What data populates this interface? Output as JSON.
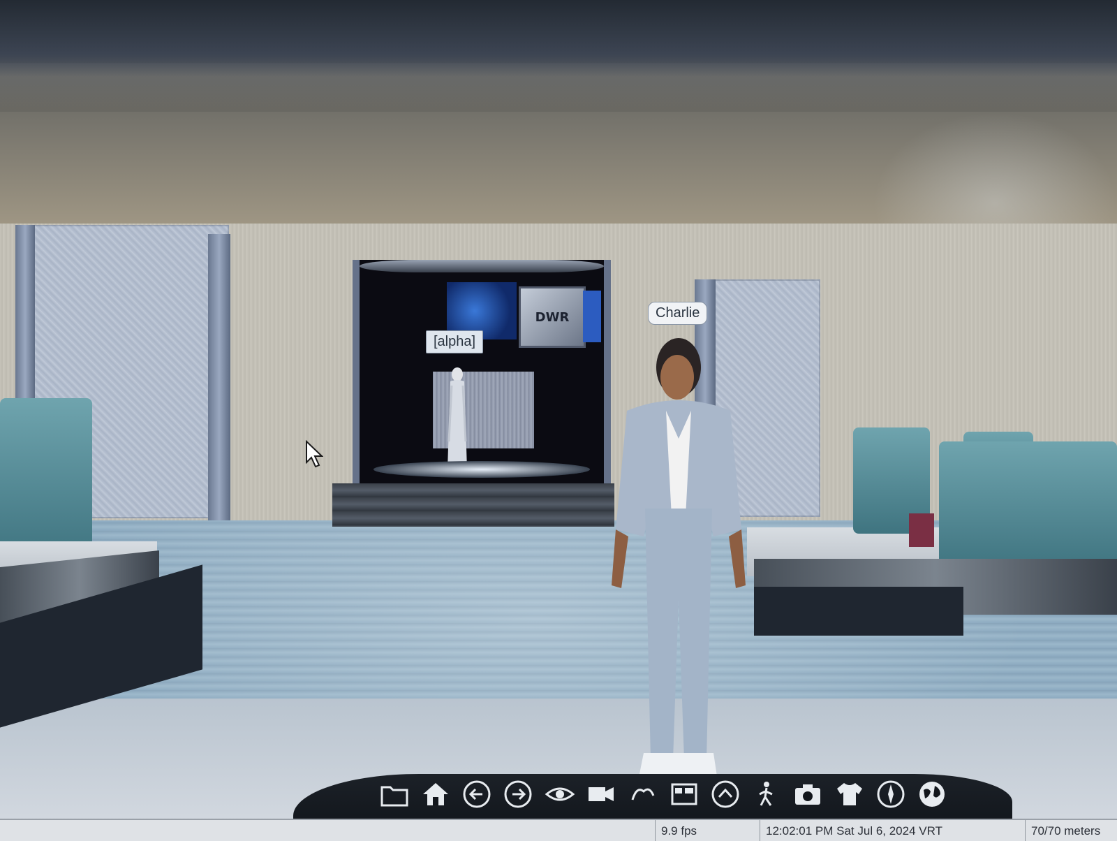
{
  "world": {
    "nametags": {
      "charlie": "Charlie",
      "alpha": "[alpha]"
    },
    "stage_logo": "DWR"
  },
  "toolbar": {
    "items": [
      {
        "name": "folder-icon",
        "icon": "folder"
      },
      {
        "name": "home-icon",
        "icon": "home"
      },
      {
        "name": "back-arrow-icon",
        "icon": "arrow-left-circle"
      },
      {
        "name": "forward-arrow-icon",
        "icon": "arrow-right-circle"
      },
      {
        "name": "eye-icon",
        "icon": "eye"
      },
      {
        "name": "camera-video-icon",
        "icon": "video-camera"
      },
      {
        "name": "gesture-icon",
        "icon": "gesture"
      },
      {
        "name": "panel-icon",
        "icon": "panel"
      },
      {
        "name": "up-arrow-icon",
        "icon": "chevron-up-circle"
      },
      {
        "name": "walk-icon",
        "icon": "walk"
      },
      {
        "name": "camera-icon",
        "icon": "camera"
      },
      {
        "name": "shirt-icon",
        "icon": "shirt"
      },
      {
        "name": "compass-icon",
        "icon": "compass"
      },
      {
        "name": "globe-icon",
        "icon": "globe"
      }
    ]
  },
  "statusbar": {
    "fps": "9.9 fps",
    "datetime": "12:02:01 PM Sat Jul 6, 2024 VRT",
    "distance": "70/70 meters"
  },
  "colors": {
    "toolbar_bg": "#12161c",
    "icon": "#e8ecf0",
    "nametag_bg": "#f1f3f6"
  }
}
